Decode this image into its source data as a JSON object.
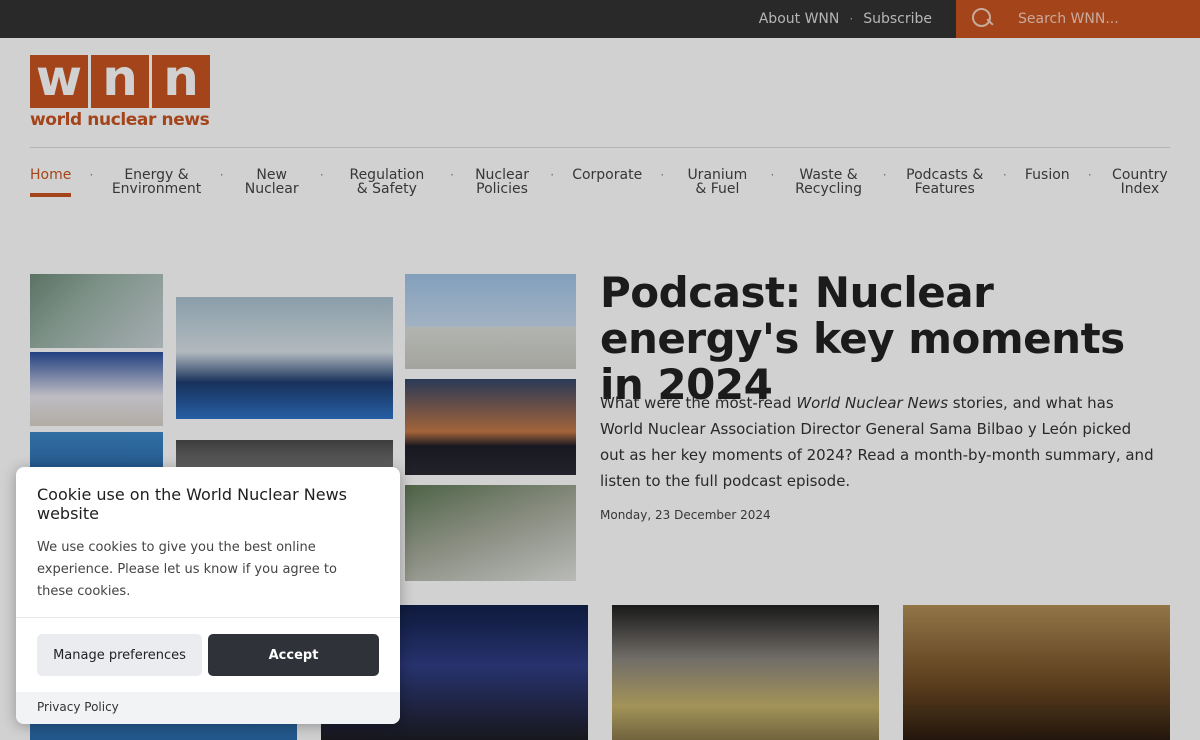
{
  "topbar": {
    "about_label": "About WNN",
    "separator": "·",
    "subscribe_label": "Subscribe",
    "search_placeholder": "Search WNN..."
  },
  "logo": {
    "letters": [
      "w",
      "n",
      "n"
    ],
    "tagline": "world nuclear news",
    "brand_color": "#c85422"
  },
  "nav": {
    "items": [
      {
        "label": "Home",
        "active": true
      },
      {
        "label": "Energy & Environment"
      },
      {
        "label": "New Nuclear"
      },
      {
        "label": "Regulation & Safety"
      },
      {
        "label": "Nuclear Policies"
      },
      {
        "label": "Corporate"
      },
      {
        "label": "Uranium & Fuel"
      },
      {
        "label": "Waste & Recycling"
      },
      {
        "label": "Podcasts & Features"
      },
      {
        "label": "Fusion"
      },
      {
        "label": "Country Index"
      }
    ],
    "separator": "·"
  },
  "feature": {
    "headline": "Podcast: Nuclear energy's key moments in 2024",
    "summary_part1": "What were the most-read ",
    "summary_italic": "World Nuclear News",
    "summary_part2": " stories, and what has World Nuclear Association Director General Sama Bilbao y León picked out as her key moments of 2024? Read a month-by-month summary, and listen to the full podcast episode.",
    "date": "Monday, 23 December 2024"
  },
  "cookie": {
    "title": "Cookie use on the World Nuclear News website",
    "body": "We use cookies to give you the best online experience. Please let us know if you agree to these cookies.",
    "manage_label": "Manage preferences",
    "accept_label": "Accept",
    "privacy_label": "Privacy Policy"
  }
}
